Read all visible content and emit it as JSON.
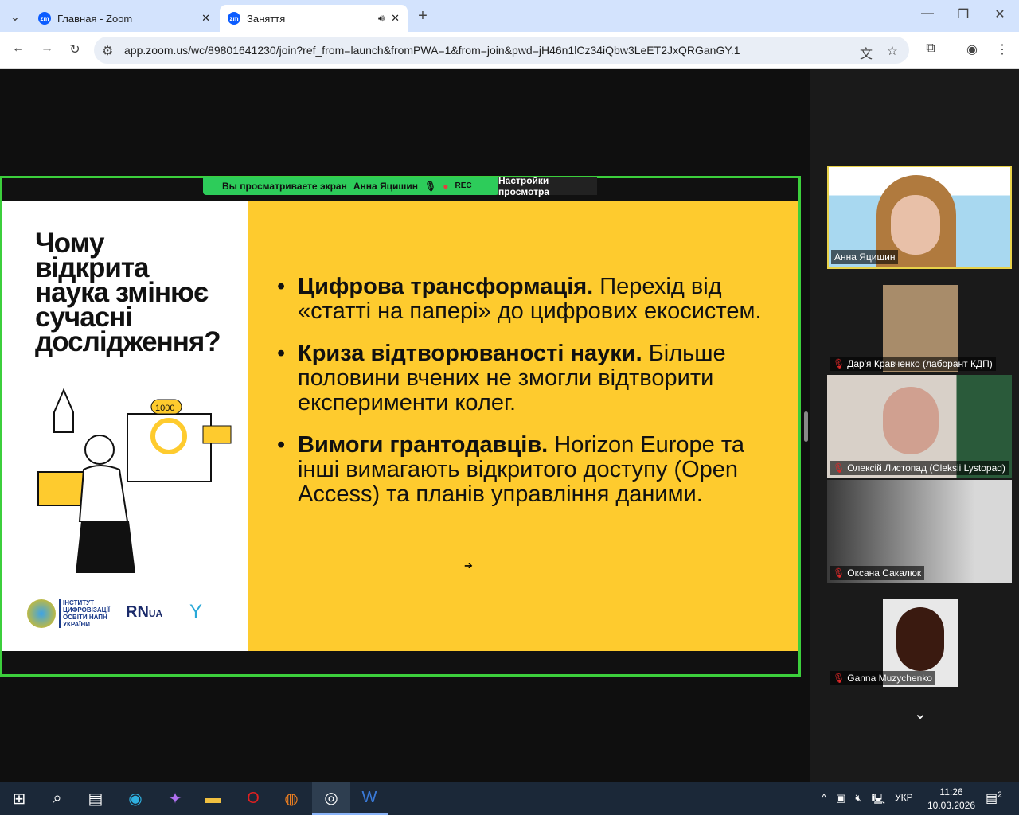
{
  "browser": {
    "tabs": [
      {
        "title": "Главная - Zoom"
      },
      {
        "title": "Заняття"
      }
    ],
    "url": "app.zoom.us/wc/89801641230/join?ref_from=launch&fromPWA=1&from=join&pwd=jH46n1lCz34iQbw3LeET2JxQRGanGY.1"
  },
  "share_banner": {
    "text": "Вы просматриваете экран",
    "presenter": "Анна Яцишин",
    "rec": "REC",
    "settings": "Настройки просмотра"
  },
  "slide": {
    "title_lines": [
      "Чому",
      "відкрита",
      "наука змінює",
      "сучасні",
      "дослідження?"
    ],
    "bullets": [
      {
        "bold": "Цифрова трансформація.",
        "text": " Перехід від «статті на папері» до цифрових екосистем."
      },
      {
        "bold": "Криза відтворюваності науки.",
        "text": " Більше половини вчених не змогли відтворити експерименти колег."
      },
      {
        "bold": "Вимоги грантодавців.",
        "text": " Horizon Europe та інші вимагають відкритого доступу (Open Access) та планів управління даними."
      }
    ],
    "logo1": "ІНСТИТУТ ЦИФРОВІЗАЦІЇ ОСВІТИ НАПН УКРАЇНИ",
    "logo2": "RN UA",
    "badge": "1000"
  },
  "participants": [
    {
      "name": "Анна Яцишин",
      "muted": false
    },
    {
      "name": "Дар'я Кравченко (лаборант КДП)",
      "muted": true
    },
    {
      "name": "Олексій Листопад (Oleksii Lystopad)",
      "muted": true
    },
    {
      "name": "Оксана Сакалюк",
      "muted": true
    },
    {
      "name": "Ganna Muzychenko",
      "muted": true
    }
  ],
  "taskbar": {
    "lang": "УКР",
    "time": "11:26",
    "date": "10.03.2026",
    "notifications": "2"
  },
  "colors": {
    "share_border": "#3ccf3c",
    "slide_yellow": "#fecb2e",
    "banner_green": "#2dcc5a"
  }
}
